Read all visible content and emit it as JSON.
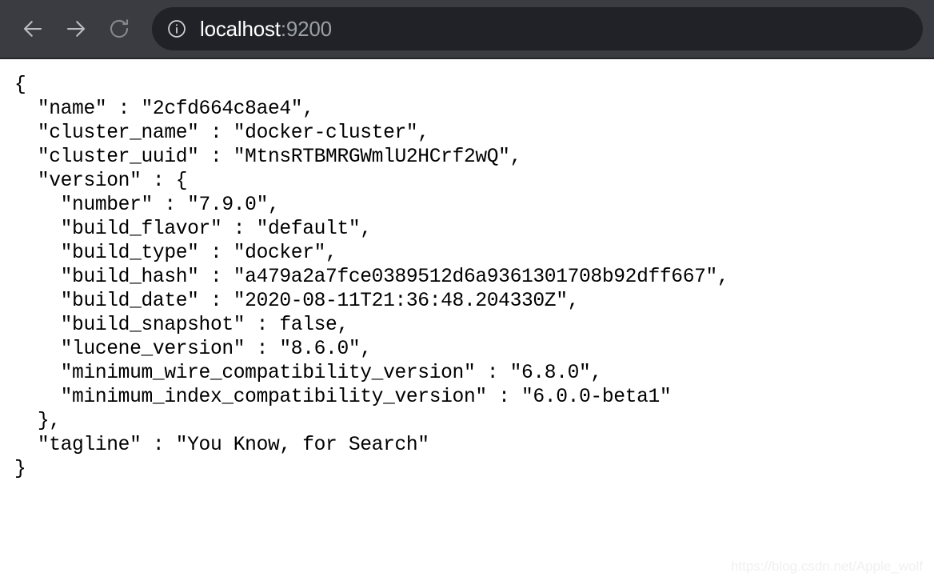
{
  "browser": {
    "back_icon": "arrow-left-icon",
    "forward_icon": "arrow-right-icon",
    "reload_icon": "reload-icon",
    "site_info_icon": "info-circle-icon",
    "url_host": "localhost",
    "url_rest": ":9200",
    "url_full": "localhost:9200",
    "colors": {
      "toolbar_bg": "#3a3c41",
      "omnibox_bg": "#212227",
      "host_text": "#ffffff",
      "rest_text": "#9aa0a6",
      "icon": "#9aa0a6"
    }
  },
  "response": {
    "name": "2cfd664c8ae4",
    "cluster_name": "docker-cluster",
    "cluster_uuid": "MtnsRTBMRGWmlU2HCrf2wQ",
    "version": {
      "number": "7.9.0",
      "build_flavor": "default",
      "build_type": "docker",
      "build_hash": "a479a2a7fce0389512d6a9361301708b92dff667",
      "build_date": "2020-08-11T21:36:48.204330Z",
      "build_snapshot": "false",
      "lucene_version": "8.6.0",
      "minimum_wire_compatibility_version": "6.8.0",
      "minimum_index_compatibility_version": "6.0.0-beta1"
    },
    "tagline": "You Know, for Search"
  },
  "json_text": "{\n  \"name\" : \"2cfd664c8ae4\",\n  \"cluster_name\" : \"docker-cluster\",\n  \"cluster_uuid\" : \"MtnsRTBMRGWmlU2HCrf2wQ\",\n  \"version\" : {\n    \"number\" : \"7.9.0\",\n    \"build_flavor\" : \"default\",\n    \"build_type\" : \"docker\",\n    \"build_hash\" : \"a479a2a7fce0389512d6a9361301708b92dff667\",\n    \"build_date\" : \"2020-08-11T21:36:48.204330Z\",\n    \"build_snapshot\" : false,\n    \"lucene_version\" : \"8.6.0\",\n    \"minimum_wire_compatibility_version\" : \"6.8.0\",\n    \"minimum_index_compatibility_version\" : \"6.0.0-beta1\"\n  },\n  \"tagline\" : \"You Know, for Search\"\n}",
  "watermark": "https://blog.csdn.net/Apple_wolf"
}
